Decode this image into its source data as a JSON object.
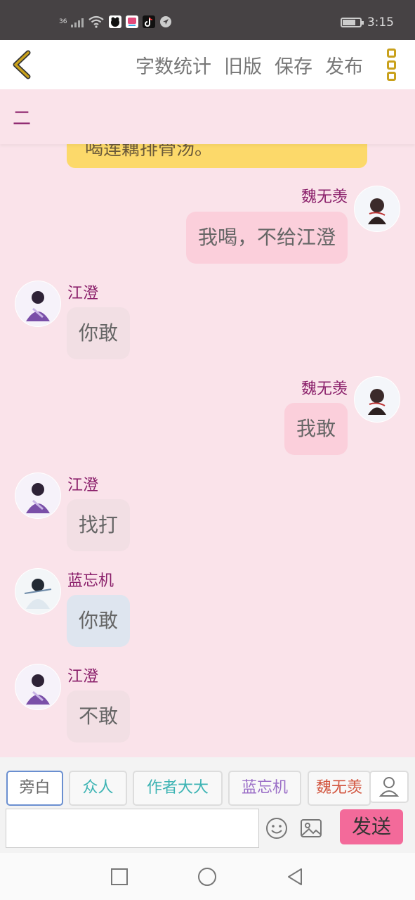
{
  "status_bar": {
    "signal": "36",
    "time": "3:15",
    "app_icons": [
      "dog-app-icon",
      "bilibili-app-icon",
      "tiktok-app-icon",
      "location-icon"
    ]
  },
  "top_bar": {
    "menu": [
      "字数统计",
      "旧版",
      "保存",
      "发布"
    ]
  },
  "chat_title": "二",
  "partial_message": "喝莲藕排骨汤。",
  "messages": [
    {
      "speaker": "魏无羡",
      "side": "right",
      "text": "我喝，不给江澄",
      "style": "wei"
    },
    {
      "speaker": "江澄",
      "side": "left",
      "text": "你敢",
      "style": "jiang"
    },
    {
      "speaker": "魏无羡",
      "side": "right",
      "text": "我敢",
      "style": "wei"
    },
    {
      "speaker": "江澄",
      "side": "left",
      "text": "找打",
      "style": "jiang"
    },
    {
      "speaker": "蓝忘机",
      "side": "left",
      "text": "你敢",
      "style": "lan"
    },
    {
      "speaker": "江澄",
      "side": "left",
      "text": "不敢",
      "style": "jiang"
    }
  ],
  "roles": [
    {
      "label": "旁白",
      "color": "#666666",
      "active": true
    },
    {
      "label": "众人",
      "color": "#3bb3b3",
      "active": false
    },
    {
      "label": "作者大大",
      "color": "#3bb3b3",
      "active": false
    },
    {
      "label": "蓝忘机",
      "color": "#9b6fc7",
      "active": false
    },
    {
      "label": "魏无羡",
      "color": "#d2553f",
      "active": false
    }
  ],
  "composer": {
    "placeholder": "",
    "send_label": "发送"
  },
  "colors": {
    "accent": "#8a1f6a",
    "send": "#f36a9a",
    "background": "#fae3ea"
  }
}
